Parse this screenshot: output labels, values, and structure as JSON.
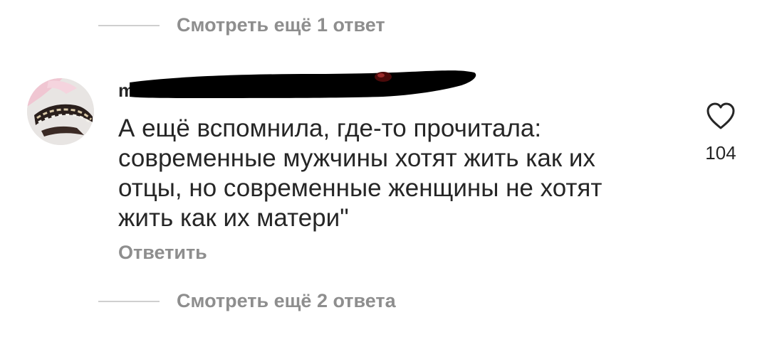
{
  "thread": {
    "view_more_top": "Смотреть ещё 1 ответ",
    "view_more_bottom": "Смотреть ещё 2 ответа"
  },
  "comment": {
    "username": "m",
    "username_redacted": true,
    "avatar_icon": "avatar-photo-icon",
    "text": "А ещё вспомнила, где-то прочитала: современные мужчины хотят жить как их отцы, но современные женщины не хотят жить как их матери\"",
    "reply_label": "Ответить",
    "like_icon": "heart-outline-icon",
    "like_count": "104"
  },
  "colors": {
    "text": "#262626",
    "secondary_text": "#8e8e8e",
    "divider": "#cfcfcf",
    "redaction": "#000000"
  }
}
